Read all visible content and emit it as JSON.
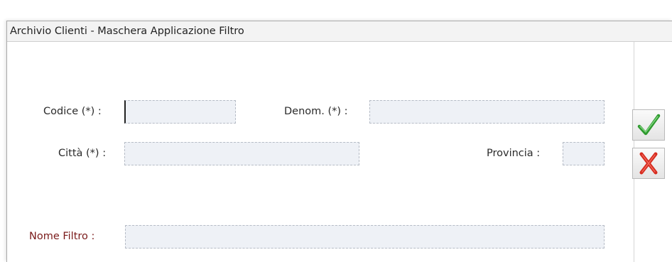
{
  "window": {
    "title": "Archivio Clienti - Maschera Applicazione Filtro"
  },
  "form": {
    "codice": {
      "label": "Codice (*) :",
      "value": ""
    },
    "denom": {
      "label": "Denom. (*) :",
      "value": ""
    },
    "citta": {
      "label": "Città (*) :",
      "value": ""
    },
    "provincia": {
      "label": "Provincia :",
      "value": ""
    },
    "nome_filtro": {
      "label": "Nome Filtro :",
      "value": ""
    }
  },
  "actions": {
    "confirm_icon": "green-checkmark-icon",
    "cancel_icon": "red-x-icon"
  },
  "colors": {
    "confirm": "#2e9a2e",
    "cancel": "#d62b1f",
    "label_highlight": "#7a1a1a",
    "field_bg": "#eef1f6"
  }
}
